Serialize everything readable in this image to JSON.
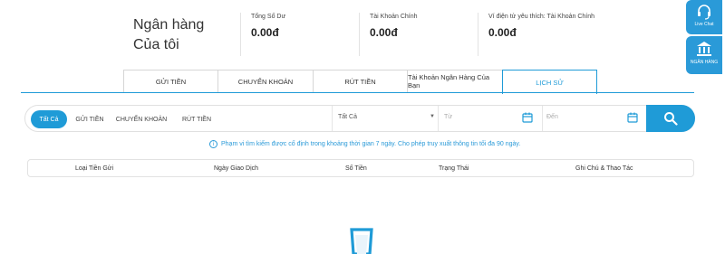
{
  "header": {
    "title_line1": "Ngân hàng",
    "title_line2": "Của tôi",
    "stats": [
      {
        "label": "Tổng Số Dư",
        "value": "0.00đ"
      },
      {
        "label": "Tài Khoản Chính",
        "value": "0.00đ"
      },
      {
        "label": "Ví điện tử yêu thích: Tài Khoản Chính",
        "value": "0.00đ"
      }
    ]
  },
  "float": {
    "livechat": "Live Chat",
    "bank": "NGÂN HÀNG"
  },
  "tabs": [
    "GỬI TIỀN",
    "CHUYỂN KHOẢN",
    "RÚT TIỀN",
    "Tài Khoản Ngân Hàng Của Bạn",
    "LỊCH SỬ"
  ],
  "active_tab": "LỊCH SỬ",
  "filter": {
    "types": [
      "Tất Cả",
      "GỬI TIỀN",
      "CHUYỂN KHOẢN",
      "RÚT TIỀN"
    ],
    "status_select": "Tất Cả",
    "from_placeholder": "Từ",
    "to_placeholder": "Đến"
  },
  "notice": "Phạm vi tìm kiếm được cố định trong khoảng thời gian 7 ngày. Cho phép truy xuất thông tin tối đa 90 ngày.",
  "table": {
    "columns": [
      "Loại Tiền Gửi",
      "Ngày Giao Dịch",
      "Số Tiền",
      "Trạng Thái",
      "Ghi Chú & Thao Tác"
    ]
  },
  "colors": {
    "accent": "#1f9bd7"
  }
}
